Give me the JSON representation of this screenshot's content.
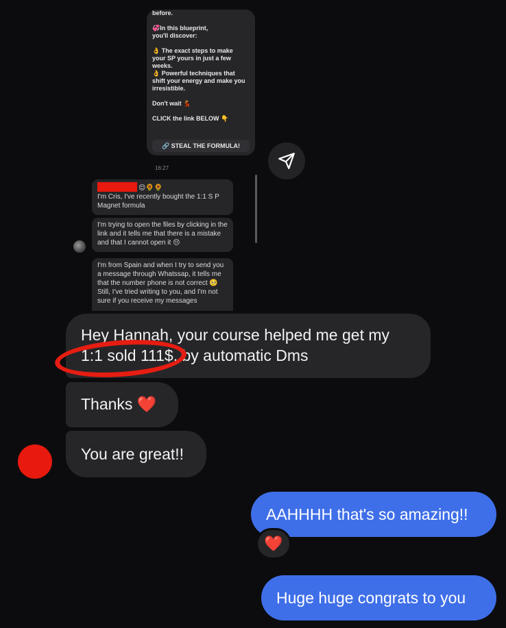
{
  "inner": {
    "promo_lines": [
      "before.",
      "",
      "💞In this blueprint,",
      "you'll discover:",
      "",
      "👌 The exact steps to make",
      "your SP yours in just a few",
      "weeks.",
      "👌 Powerful techniques that",
      "shift your energy and make you",
      "irresistible.",
      "",
      "Don't wait 💃",
      "",
      "CLICK the link BELOW 👇"
    ],
    "cta_label": "🔗 STEAL THE FORMULA!",
    "timestamp": "16:27",
    "messages": [
      {
        "text": "😌🌻🌻\nI'm Cris, I've recently bought the 1:1 S P Magnet formula"
      },
      {
        "text": "I'm trying to open the files by clicking in the link and it tells me that there is a mistake and that I cannot open it 😔"
      },
      {
        "text": "I'm from Spain and when I try to send you a message through Whatssap, it tells me that the number phone is not correct 🥺  Still, I've tried writing to you, and I'm not sure if you receive my messages"
      }
    ]
  },
  "conversation": {
    "incoming": [
      "Hey Hannah, your course helped me get my 1:1 sold 111$, by automatic Dms",
      "Thanks ❤️",
      "You are great!!"
    ],
    "outgoing": [
      "AAHHHH that's so amazing!!",
      "Huge huge congrats to you"
    ],
    "reaction": "❤️"
  },
  "colors": {
    "background": "#0c0c0e",
    "incoming_bubble": "#262629",
    "outgoing_bubble": "#3f6fe8",
    "annotation_red": "#e61d12"
  },
  "icons": {
    "share": "paper-plane-icon",
    "heart": "heart-icon"
  }
}
